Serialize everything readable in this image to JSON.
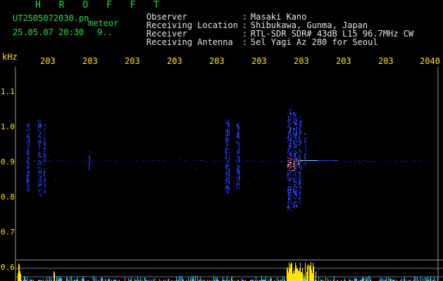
{
  "header": {
    "title": "H R O F F T",
    "file": "UT2505072030.pn",
    "meteor_label": "meteor",
    "datetime": "25.05.07 20:30",
    "count": "9.."
  },
  "info": [
    {
      "key": "Observer",
      "value": "Masaki Kano"
    },
    {
      "key": "Receiving Location",
      "value": "Shibukawa, Gunma, Japan"
    },
    {
      "key": "Receiver",
      "value": "RTL-SDR SDR# 43dB L15 96.7MHz CW"
    },
    {
      "key": "Receiving Antenna",
      "value": "5el Yagi Az 280 for Seoul"
    }
  ],
  "axis": {
    "unit": "kHz",
    "y_ticks": [
      "1.1",
      "1.0",
      "0.9",
      "0.8",
      "0.7",
      "0.6"
    ],
    "x_ticks": [
      "203",
      "203",
      "203",
      "203",
      "203",
      "203",
      "203",
      "203",
      "203",
      "2040"
    ]
  },
  "colors": {
    "background": "#000000",
    "text_green": "#22e04a",
    "text_yellow": "#ffe600",
    "signal_blue": "#2a3cff",
    "signal_hot": "#ff2a2a",
    "activity_cyan": "#00d8ff",
    "activity_yellow": "#ffe600"
  }
}
